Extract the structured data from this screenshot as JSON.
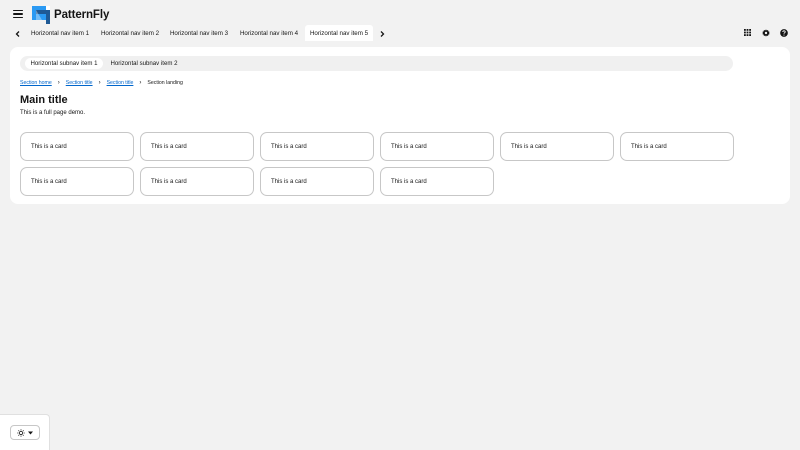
{
  "brand": {
    "name": "PatternFly"
  },
  "header": {
    "menu_icon": "hamburger-icon",
    "tools": [
      {
        "name": "apps-grid-icon"
      },
      {
        "name": "gear-icon"
      },
      {
        "name": "help-icon"
      }
    ]
  },
  "nav": {
    "items": [
      {
        "label": "Horizontal nav item 1"
      },
      {
        "label": "Horizontal nav item 2"
      },
      {
        "label": "Horizontal nav item 3"
      },
      {
        "label": "Horizontal nav item 4"
      },
      {
        "label": "Horizontal nav item 5"
      }
    ],
    "active_index": 4
  },
  "subnav": {
    "items": [
      {
        "label": "Horizontal subnav item 1"
      },
      {
        "label": "Horizontal subnav item 2"
      }
    ],
    "active_index": 0
  },
  "breadcrumb": {
    "items": [
      {
        "label": "Section home"
      },
      {
        "label": "Section title"
      },
      {
        "label": "Section title"
      },
      {
        "label": "Section landing"
      }
    ]
  },
  "main": {
    "title": "Main title",
    "description": "This is a full page demo."
  },
  "cards": [
    {
      "label": "This is a card"
    },
    {
      "label": "This is a card"
    },
    {
      "label": "This is a card"
    },
    {
      "label": "This is a card"
    },
    {
      "label": "This is a card"
    },
    {
      "label": "This is a card"
    },
    {
      "label": "This is a card"
    },
    {
      "label": "This is a card"
    },
    {
      "label": "This is a card"
    },
    {
      "label": "This is a card"
    }
  ],
  "theme_switcher": {
    "icon": "sun-icon",
    "caret": "caret-down-icon"
  },
  "colors": {
    "background": "#f2f2f2",
    "panel": "#ffffff",
    "link": "#0066cc",
    "logo_blue": "#2b9af3",
    "logo_dark": "#1f5a96"
  }
}
